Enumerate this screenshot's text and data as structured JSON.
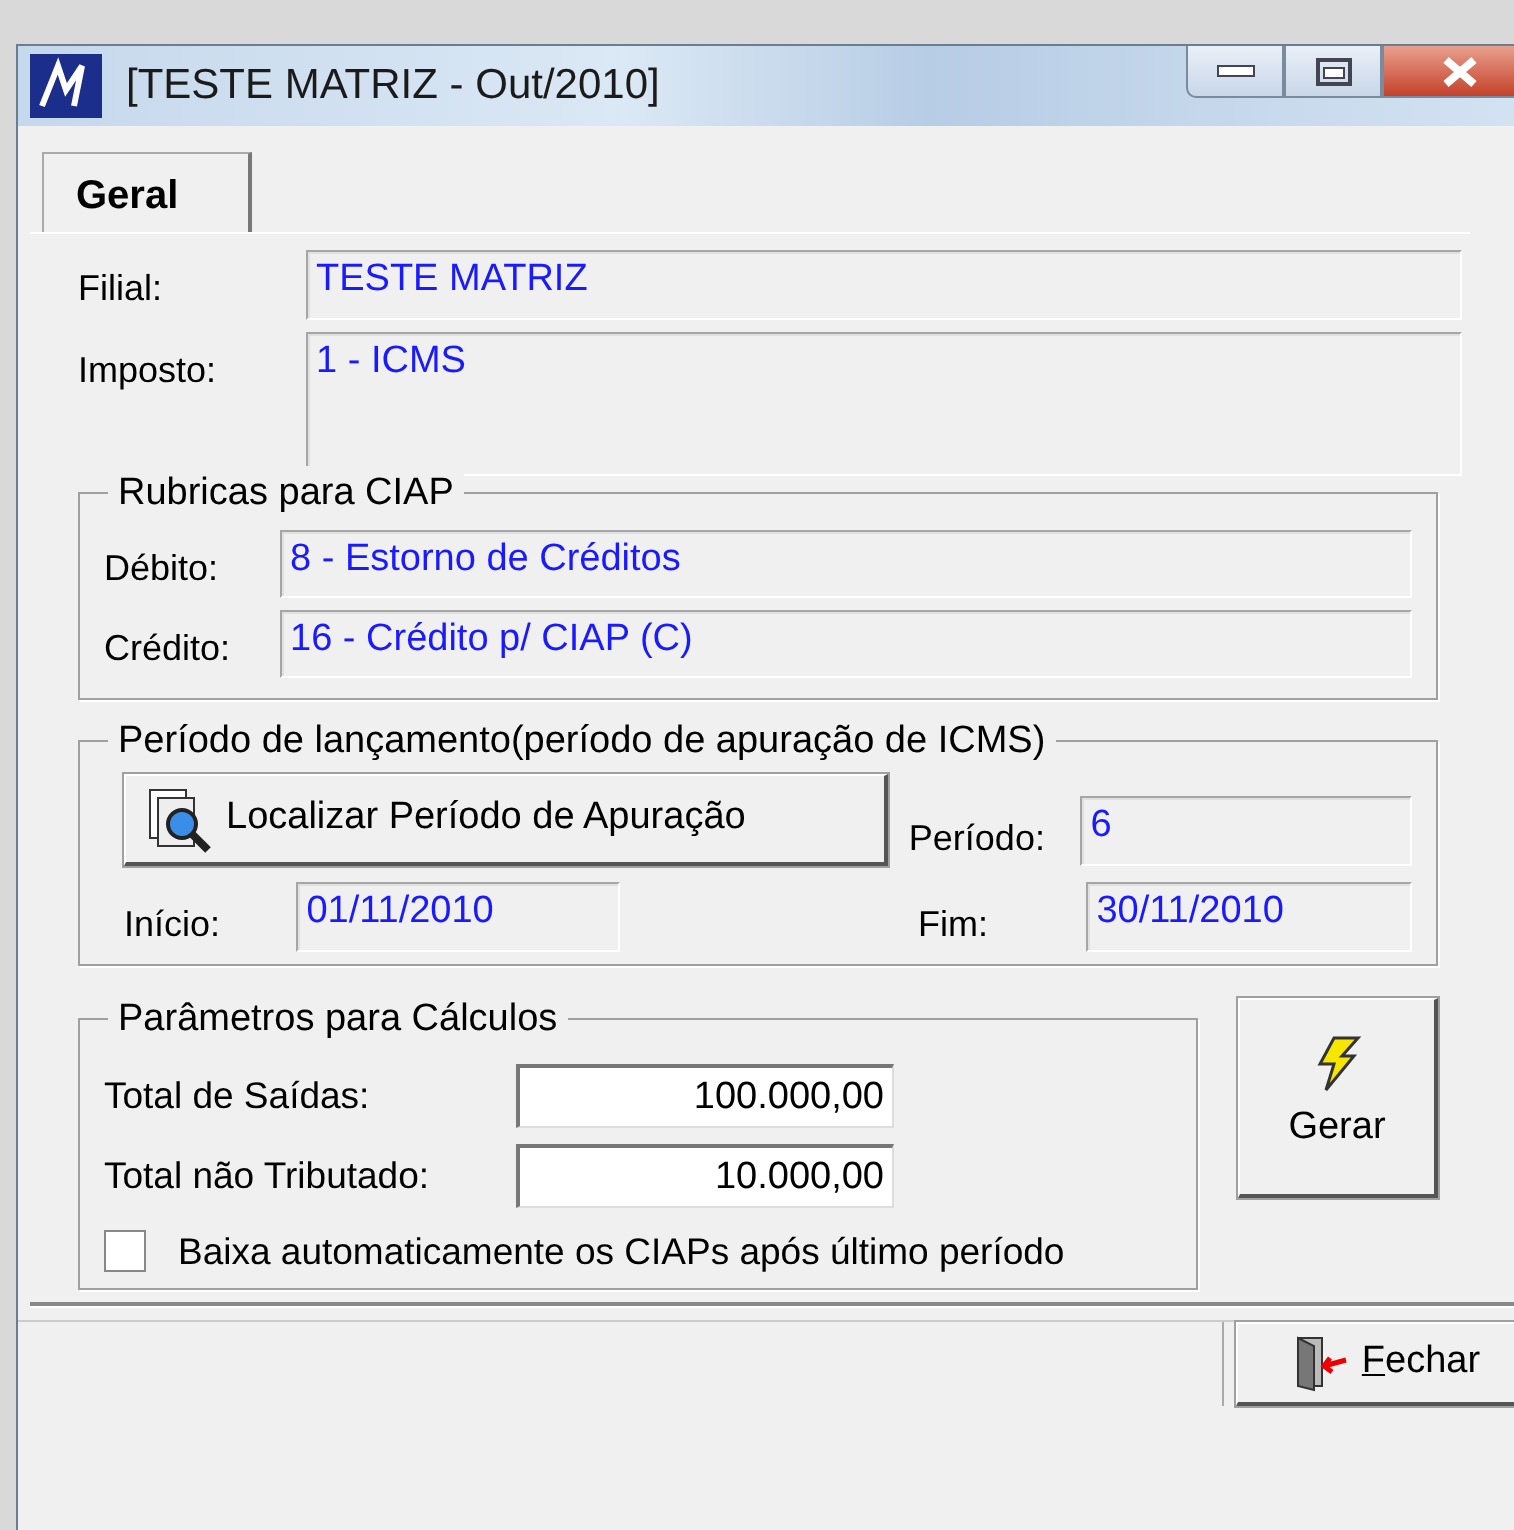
{
  "window": {
    "title": "[TESTE MATRIZ - Out/2010]"
  },
  "tabs": [
    {
      "label": "Geral",
      "selected": true
    }
  ],
  "header_fields": [
    {
      "label": "Filial:",
      "value": "TESTE MATRIZ",
      "kind": "single"
    },
    {
      "label": "Imposto:",
      "value": "1 - ICMS",
      "kind": "multi"
    }
  ],
  "rubricas": {
    "title": "Rubricas para CIAP",
    "fields": [
      {
        "label": "Débito:",
        "value": "8 - Estorno de Créditos"
      },
      {
        "label": "Crédito:",
        "value": "16 - Crédito p/ CIAP (C)"
      }
    ]
  },
  "periodo": {
    "title": "Período de lançamento(período de apuração de ICMS)",
    "button": "Localizar Período de Apuração",
    "periodo_label": "Período:",
    "periodo_value": "6",
    "inicio_label": "Início:",
    "inicio_value": "01/11/2010",
    "fim_label": "Fim:",
    "fim_value": "30/11/2010"
  },
  "parametros": {
    "title": "Parâmetros para Cálculos",
    "inputs": [
      {
        "label": "Total de Saídas:",
        "value": "100.000,00"
      },
      {
        "label": "Total não Tributado:",
        "value": "10.000,00"
      }
    ],
    "checkbox": {
      "label": "Baixa automaticamente os CIAPs após último período",
      "checked": false
    }
  },
  "gerar_button": "Gerar",
  "fechar_button": "Fechar"
}
